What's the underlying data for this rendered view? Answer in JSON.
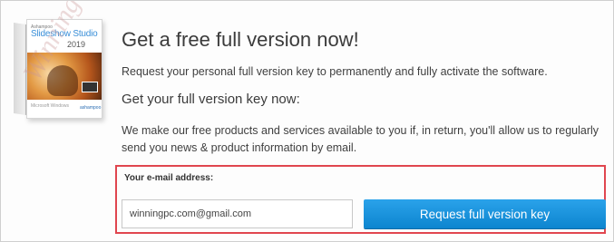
{
  "product": {
    "brand": "Ashampoo",
    "name": "Slideshow Studio",
    "year": "2019",
    "box_foot": "Microsoft Windows",
    "box_logo": "ashampoo"
  },
  "watermark": "Winning PC",
  "header": {
    "title": "Get a free full version now!",
    "description": "Request your personal full version key to permanently and fully activate the software."
  },
  "section": {
    "subtitle": "Get your full version key now:",
    "paragraph": "We make our free products and services available to you if, in return, you'll allow us to regularly send you news & product information by email."
  },
  "form": {
    "email_label": "Your e-mail address:",
    "email_value": "winningpc.com@gmail.com",
    "submit_label": "Request full version key"
  },
  "colors": {
    "highlight_border": "#e0464f",
    "button": "#1a96de",
    "product_accent": "#3a8fd8"
  }
}
